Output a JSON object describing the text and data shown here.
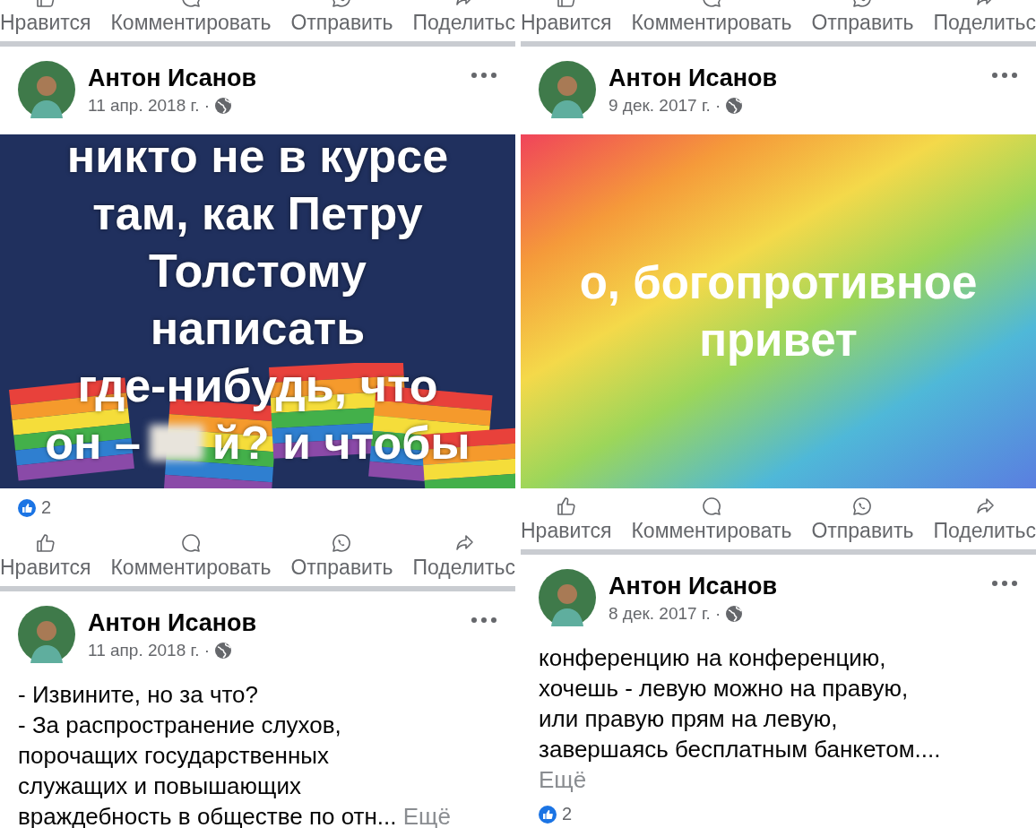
{
  "columns": [
    {
      "blocks": [
        {
          "kind": "actions",
          "items": [
            {
              "kind": "like",
              "label": "Нравится"
            },
            {
              "kind": "comment",
              "label": "Комментировать"
            },
            {
              "kind": "send",
              "label": "Отправить"
            },
            {
              "kind": "share",
              "label": "Поделитьс"
            }
          ]
        },
        {
          "kind": "flag_post",
          "author": "Антон Исанов",
          "date": "11 апр. 2018 г. ·",
          "text": "никто не в курсе\nтам, как Петру\nТолстому\nнаписать\nгде-нибудь, что",
          "text_tail": [
            "он –",
            "й? и чтобы"
          ],
          "likes": "2"
        },
        {
          "kind": "actions",
          "items": [
            {
              "kind": "like",
              "label": "Нравится"
            },
            {
              "kind": "comment",
              "label": "Комментировать"
            },
            {
              "kind": "send",
              "label": "Отправить"
            },
            {
              "kind": "share",
              "label": "Поделитьс"
            }
          ]
        },
        {
          "kind": "text_post",
          "author": "Антон Исанов",
          "date": "11 апр. 2018 г. ·",
          "text": "- Извините, но за что?\n- За распространение слухов,\nпорочащих государственных\nслужащих и повышающих\nвраждебность в обществе по отн...",
          "more": "Ещё",
          "more_inline": true
        }
      ]
    },
    {
      "blocks": [
        {
          "kind": "actions",
          "items": [
            {
              "kind": "like",
              "label": "Нравится"
            },
            {
              "kind": "comment",
              "label": "Комментировать"
            },
            {
              "kind": "send",
              "label": "Отправить"
            },
            {
              "kind": "share",
              "label": "Поделитьс"
            }
          ]
        },
        {
          "kind": "rainbow_post",
          "author": "Антон Исанов",
          "date": "9 дек. 2017 г. ·",
          "text": "о, богопротивное привет"
        },
        {
          "kind": "actions",
          "items": [
            {
              "kind": "like",
              "label": "Нравится"
            },
            {
              "kind": "comment",
              "label": "Комментировать"
            },
            {
              "kind": "send",
              "label": "Отправить"
            },
            {
              "kind": "share",
              "label": "Поделитьс"
            }
          ]
        },
        {
          "kind": "text_post",
          "author": "Антон Исанов",
          "date": "8 дек. 2017 г. ·",
          "text": "конференцию на конференцию,\nхочешь - левую можно на правую,\nили правую прям на левую,\nзавершаясь бесплатным банкетом....",
          "more": "Ещё",
          "more_inline": false,
          "likes": "2"
        }
      ]
    }
  ]
}
